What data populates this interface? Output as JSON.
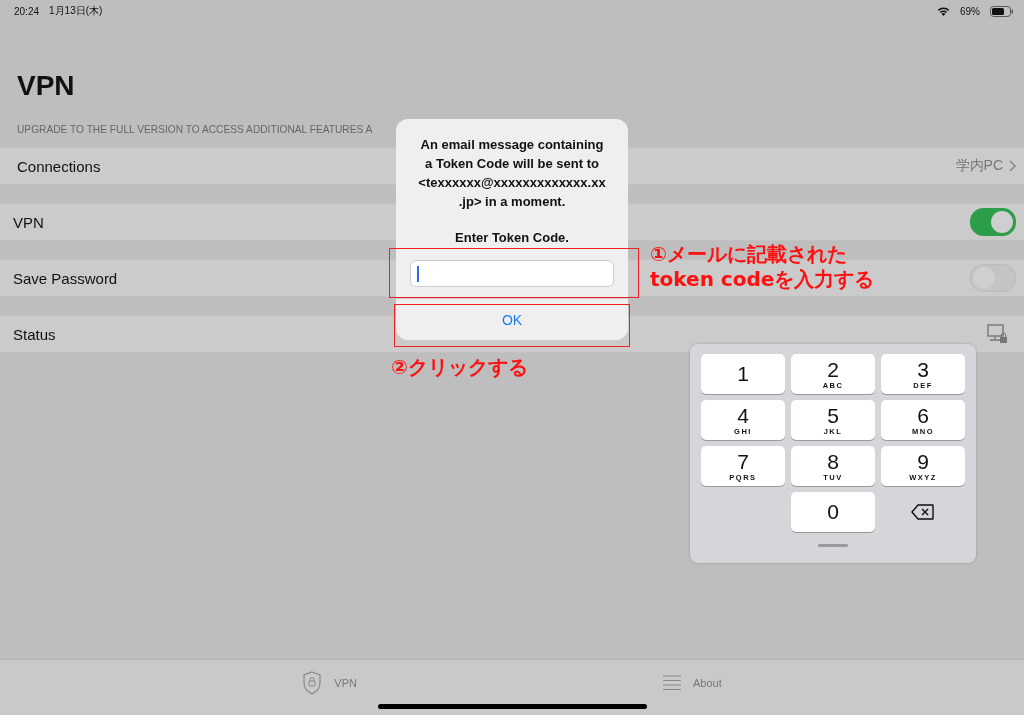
{
  "status_bar": {
    "time": "20:24",
    "date": "1月13日(木)",
    "battery": "69%"
  },
  "title": "VPN",
  "section_header": "UPGRADE TO THE FULL VERSION TO ACCESS ADDITIONAL FEATURES A",
  "rows": [
    {
      "kind": "link",
      "label": "Connections",
      "value": "学内PC"
    },
    {
      "kind": "toggle",
      "label": "VPN",
      "on": true
    },
    {
      "kind": "toggle",
      "label": "Save Password",
      "on": false
    },
    {
      "kind": "status",
      "label": "Status"
    }
  ],
  "dialog": {
    "message_lines": [
      "An email message containing",
      "a Token Code will be sent to",
      "<texxxxxx@xxxxxxxxxxxxx.xx",
      ".jp> in a moment."
    ],
    "prompt": "Enter Token Code.",
    "input": {
      "focused": true
    },
    "button": "OK"
  },
  "annotations": [
    {
      "kind": "field",
      "lines": [
        "①メールに記載された",
        "token codeを入力する"
      ]
    },
    {
      "kind": "button",
      "lines": [
        "②クリックする"
      ]
    }
  ],
  "keypad": [
    {
      "kind": "digit",
      "digit": "1"
    },
    {
      "kind": "digit",
      "digit": "2",
      "letters": "ABC"
    },
    {
      "kind": "digit",
      "digit": "3",
      "letters": "DEF"
    },
    {
      "kind": "digit",
      "digit": "4",
      "letters": "GHI"
    },
    {
      "kind": "digit",
      "digit": "5",
      "letters": "JKL"
    },
    {
      "kind": "digit",
      "digit": "6",
      "letters": "MNO"
    },
    {
      "kind": "digit",
      "digit": "7",
      "letters": "PQRS"
    },
    {
      "kind": "digit",
      "digit": "8",
      "letters": "TUV"
    },
    {
      "kind": "digit",
      "digit": "9",
      "letters": "WXYZ"
    },
    {
      "kind": "blank"
    },
    {
      "kind": "digit",
      "digit": "0"
    },
    {
      "kind": "delete"
    }
  ],
  "tabs": [
    {
      "kind": "shield",
      "label": "VPN"
    },
    {
      "kind": "list",
      "label": "About"
    }
  ]
}
